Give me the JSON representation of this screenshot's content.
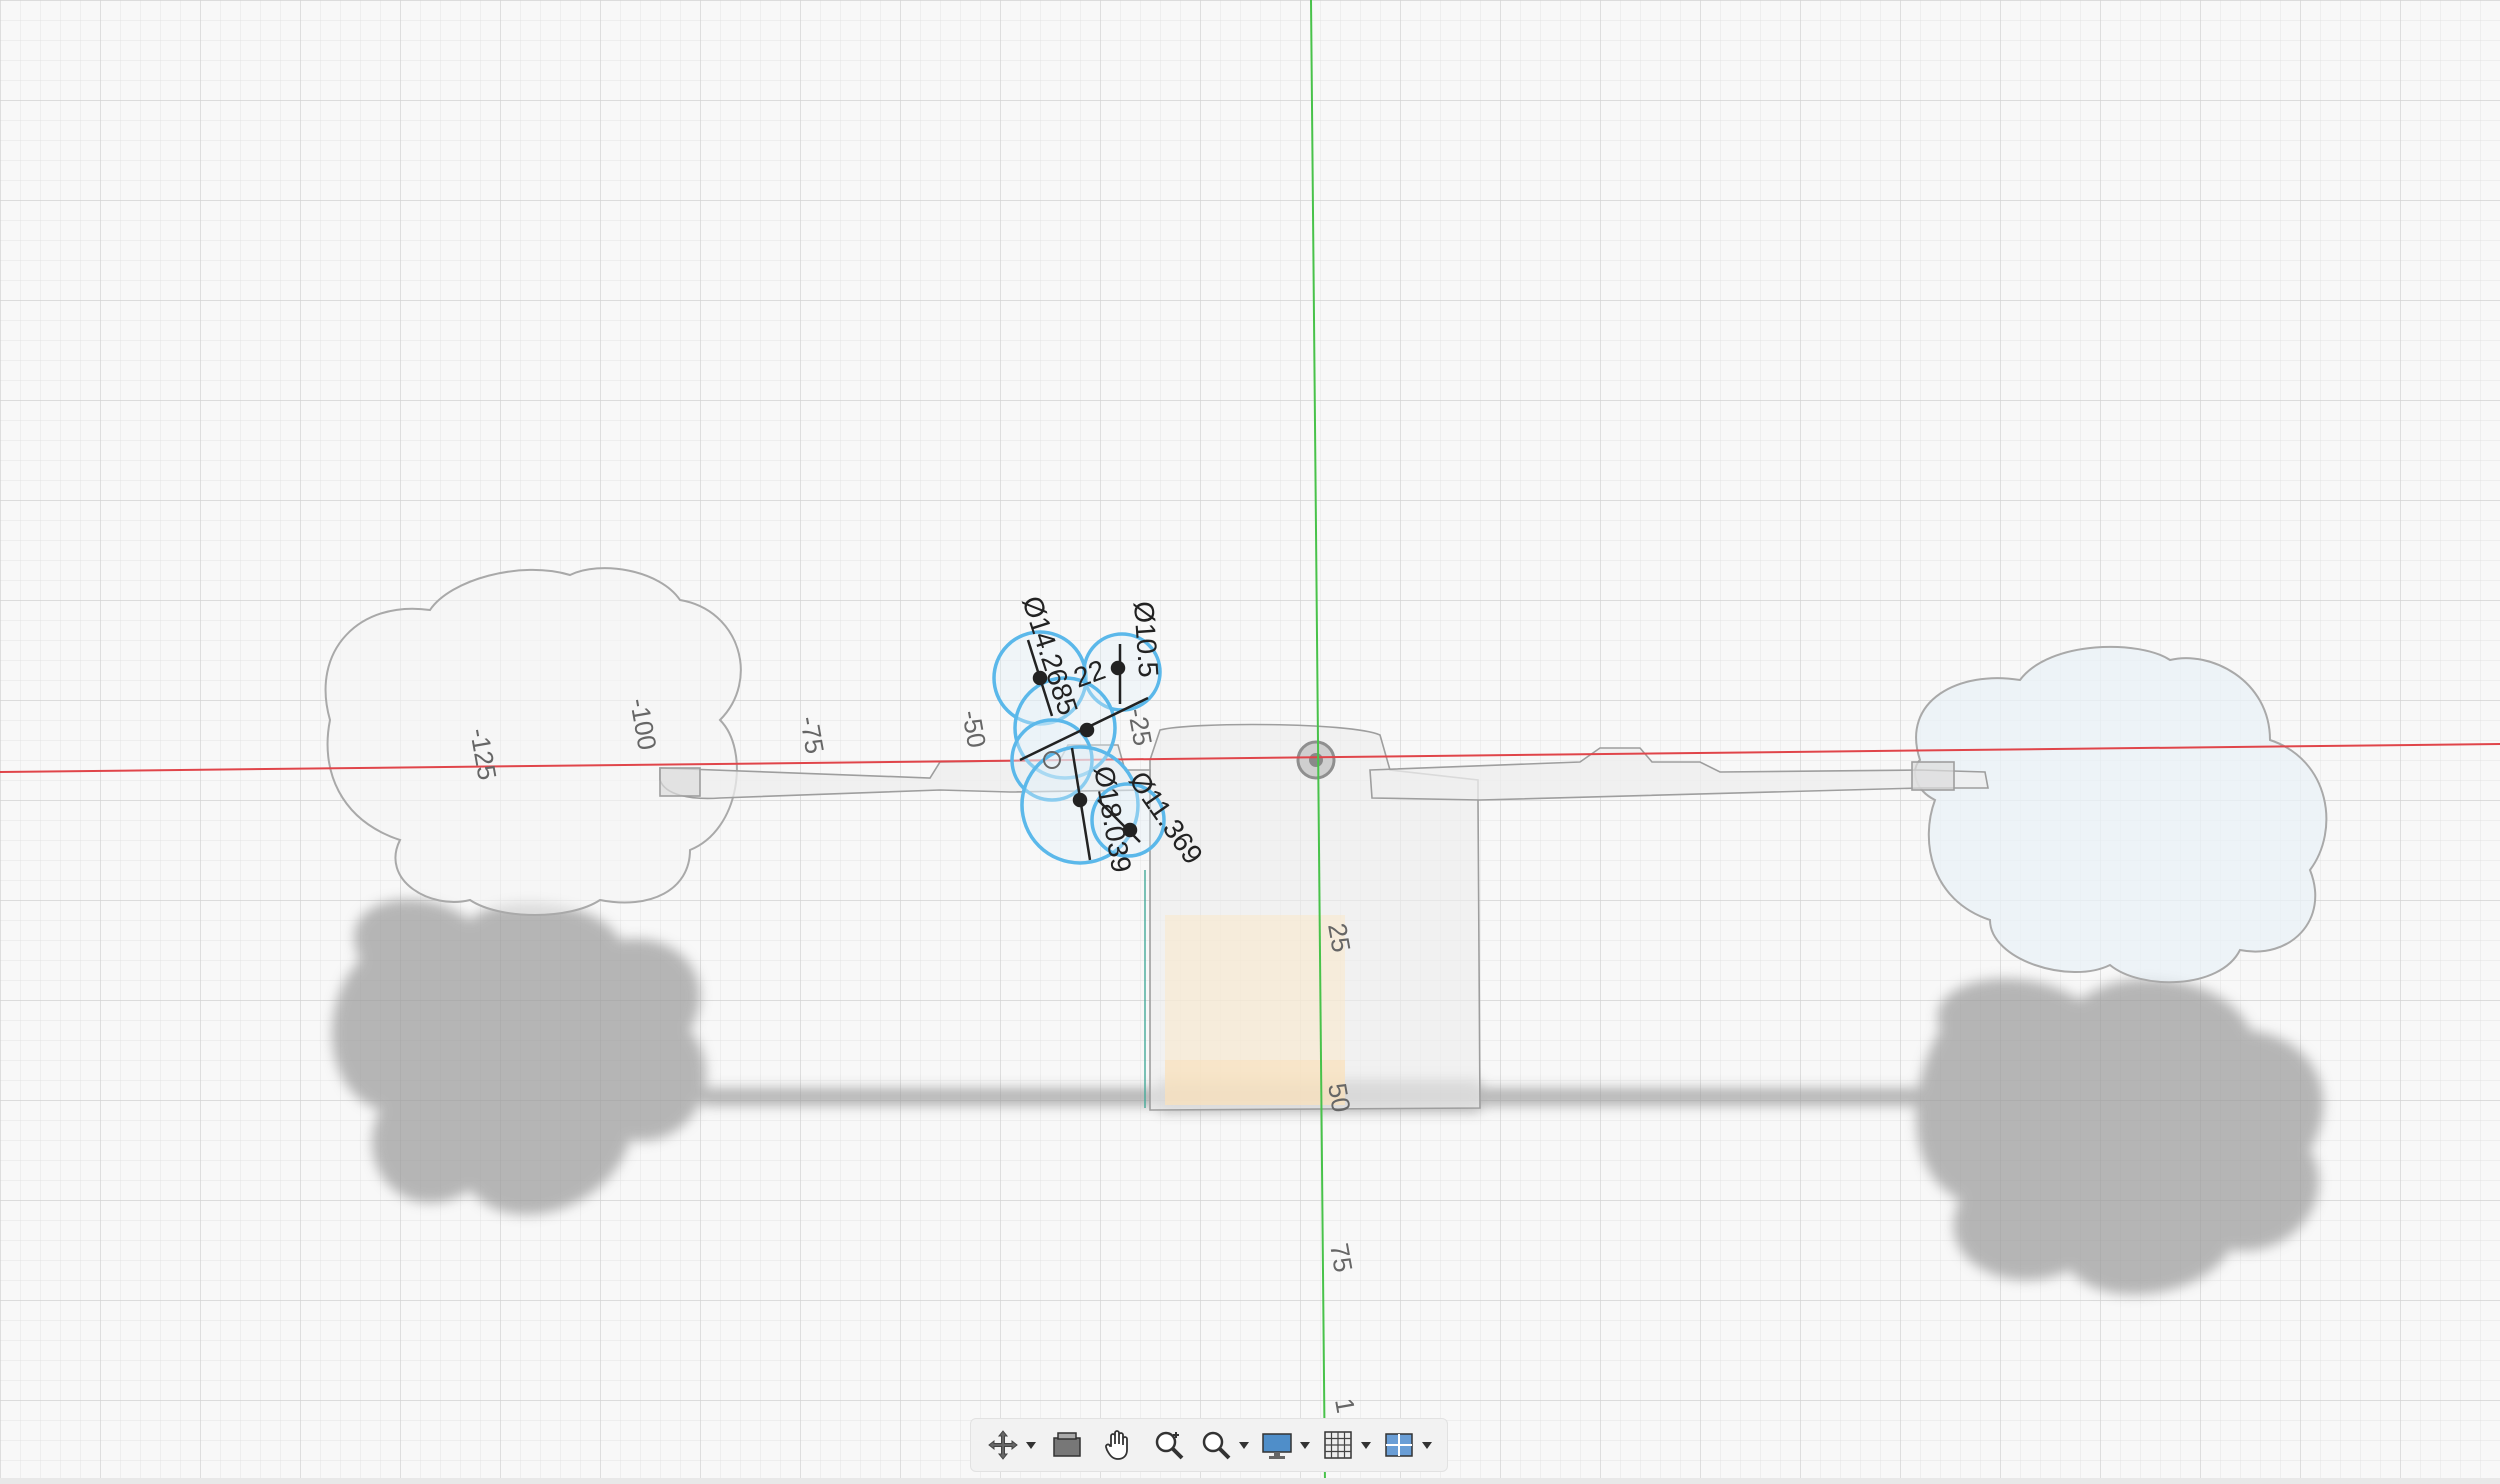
{
  "viewport": {
    "axis_colors": {
      "x_axis": "#e0454a",
      "y_axis": "#48c24a"
    },
    "grid": "on",
    "axis_ticks": {
      "horizontal": [
        "-125",
        "-100",
        "-75",
        "-50",
        "-25"
      ],
      "vertical": [
        "25",
        "50",
        "75",
        "1"
      ]
    },
    "dimensions": [
      "Ø14.2685",
      "22",
      "Ø10.5",
      "Ø18.039",
      "Ø11.369"
    ],
    "selection_color": "#5bb8ea"
  },
  "nav_toolbar": {
    "items": [
      {
        "name": "orbit",
        "icon": "orbit-icon",
        "dropdown": true
      },
      {
        "name": "look-at",
        "icon": "look-at-icon",
        "dropdown": false
      },
      {
        "name": "pan",
        "icon": "hand-icon",
        "dropdown": false
      },
      {
        "name": "zoom",
        "icon": "zoom-icon",
        "dropdown": false
      },
      {
        "name": "fit",
        "icon": "zoom-window-icon",
        "dropdown": true
      },
      {
        "name": "display-settings",
        "icon": "monitor-icon",
        "dropdown": true
      },
      {
        "name": "grid-settings",
        "icon": "grid-icon",
        "dropdown": true
      },
      {
        "name": "viewports",
        "icon": "viewports-icon",
        "dropdown": true
      }
    ]
  }
}
